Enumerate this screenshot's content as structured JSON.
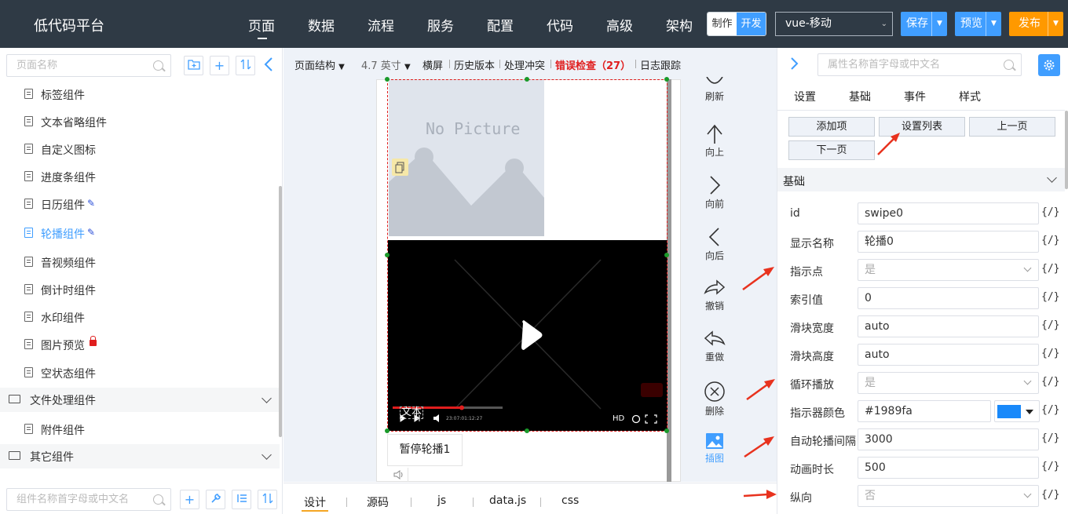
{
  "header": {
    "app_title": "低代码平台",
    "nav": [
      "页面",
      "数据",
      "流程",
      "服务",
      "配置",
      "代码",
      "高级",
      "架构"
    ],
    "mode_make": "制作",
    "mode_dev": "开发",
    "platform_select": "vue-移动",
    "save_label": "保存",
    "preview_label": "预览",
    "publish_label": "发布",
    "colors": {
      "bg": "#2f3a45",
      "save": "#409eff",
      "publish": "#ff9900"
    }
  },
  "left": {
    "search_placeholder": "页面名称",
    "items": [
      {
        "label": "标签组件",
        "badge": ""
      },
      {
        "label": "文本省略组件",
        "badge": ""
      },
      {
        "label": "自定义图标",
        "badge": ""
      },
      {
        "label": "进度条组件",
        "badge": ""
      },
      {
        "label": "日历组件",
        "badge": "pen"
      },
      {
        "label": "轮播组件",
        "badge": "pen",
        "active": true
      },
      {
        "label": "音视频组件",
        "badge": ""
      },
      {
        "label": "倒计时组件",
        "badge": ""
      },
      {
        "label": "水印组件",
        "badge": ""
      },
      {
        "label": "图片预览",
        "badge": "lock"
      },
      {
        "label": "空状态组件",
        "badge": ""
      }
    ],
    "group_file": "文件处理组件",
    "file_items": [
      "附件组件"
    ],
    "group_other": "其它组件",
    "component_search_placeholder": "组件名称首字母或中文名"
  },
  "toolbar": {
    "structure": "页面结构",
    "size": "4.7 英寸",
    "landscape": "横屏",
    "history": "历史版本",
    "conflict": "处理冲突",
    "error_check": "错误检查（27）",
    "log": "日志跟踪"
  },
  "canvas": {
    "no_picture": "No Picture",
    "video_text": "文本",
    "video_time": "23:07:01:12:27",
    "video_hd": "HD",
    "pause_button": "暂停轮播1"
  },
  "side_tools": [
    "刷新",
    "向上",
    "向前",
    "向后",
    "撤销",
    "重做",
    "删除",
    "插图"
  ],
  "bottom_tabs": [
    "设计",
    "源码",
    "js",
    "data.js",
    "css"
  ],
  "right": {
    "search_placeholder": "属性名称首字母或中文名",
    "tabs": [
      "设置",
      "基础",
      "事件",
      "样式"
    ],
    "buttons": [
      "添加项",
      "设置列表",
      "上一页",
      "下一页"
    ],
    "section": "基础",
    "props": [
      {
        "label": "id",
        "value": "swipe0",
        "type": "input"
      },
      {
        "label": "显示名称",
        "value": "轮播0",
        "type": "input"
      },
      {
        "label": "指示点",
        "value": "是",
        "type": "select"
      },
      {
        "label": "索引值",
        "value": "0",
        "type": "input"
      },
      {
        "label": "滑块宽度",
        "value": "auto",
        "type": "input"
      },
      {
        "label": "滑块高度",
        "value": "auto",
        "type": "input"
      },
      {
        "label": "循环播放",
        "value": "是",
        "type": "select"
      },
      {
        "label": "指示器颜色",
        "value": "#1989fa",
        "type": "color"
      },
      {
        "label": "自动轮播间隔",
        "value": "3000",
        "type": "input"
      },
      {
        "label": "动画时长",
        "value": "500",
        "type": "input"
      },
      {
        "label": "纵向",
        "value": "否",
        "type": "select"
      }
    ],
    "expr": "{/}",
    "swatch_color": "#1989fa"
  }
}
